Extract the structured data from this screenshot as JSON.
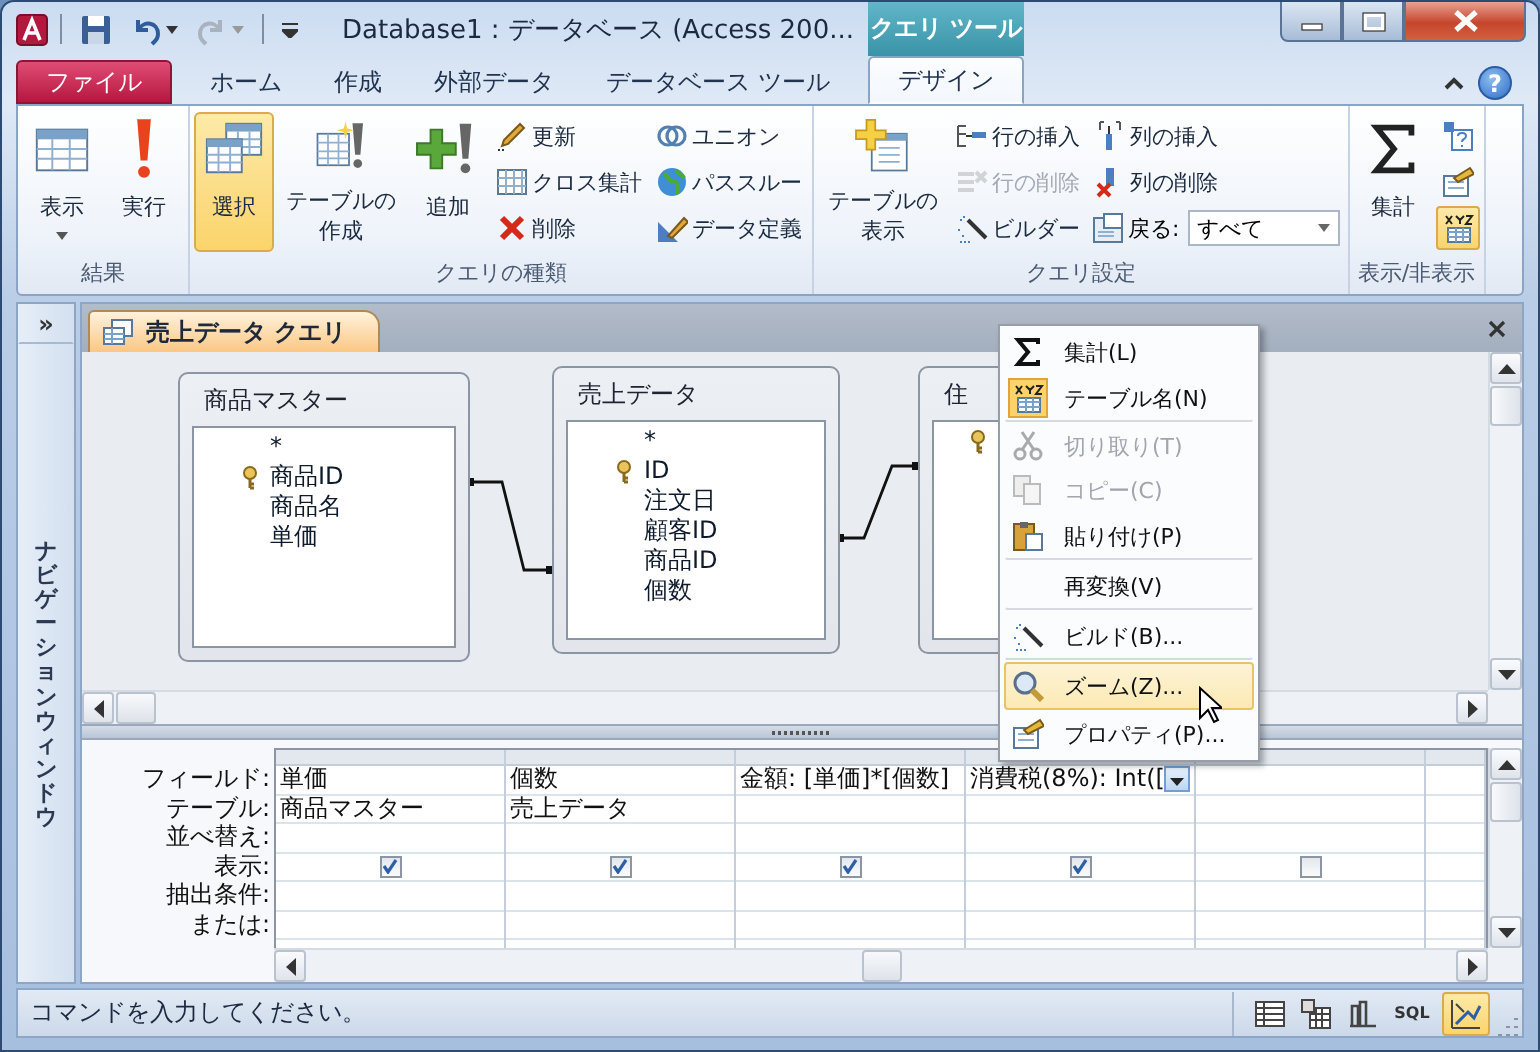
{
  "window": {
    "title": "Database1 : データベース (Access 200...",
    "context_group": "クエリ ツール",
    "help": "?"
  },
  "tabs": [
    {
      "label": "ファイル",
      "kind": "file",
      "selected": false
    },
    {
      "label": "ホーム",
      "kind": "normal",
      "selected": false
    },
    {
      "label": "作成",
      "kind": "normal",
      "selected": false
    },
    {
      "label": "外部データ",
      "kind": "normal",
      "selected": false
    },
    {
      "label": "データベース ツール",
      "kind": "normal",
      "selected": false
    },
    {
      "label": "デザイン",
      "kind": "context",
      "selected": true
    }
  ],
  "ribbon": {
    "groups": [
      {
        "label": "結果",
        "controls": [
          {
            "kind": "large",
            "label": "表示",
            "dropdown": true,
            "selected": false
          },
          {
            "kind": "large",
            "label": "実行",
            "selected": false
          }
        ]
      },
      {
        "label": "クエリの種類",
        "controls": [
          {
            "kind": "large",
            "label": "選択",
            "selected": true
          },
          {
            "kind": "large",
            "label": "テーブルの作成",
            "selected": false
          },
          {
            "kind": "large",
            "label": "追加",
            "selected": false
          },
          {
            "kind": "stack",
            "items": [
              {
                "kind": "button",
                "label": "更新",
                "disabled": false
              },
              {
                "kind": "button",
                "label": "クロス集計",
                "disabled": false
              },
              {
                "kind": "button",
                "label": "削除",
                "disabled": false
              }
            ]
          },
          {
            "kind": "stack",
            "items": [
              {
                "kind": "button",
                "label": "ユニオン",
                "disabled": false
              },
              {
                "kind": "button",
                "label": "パススルー",
                "disabled": false
              },
              {
                "kind": "button",
                "label": "データ定義",
                "disabled": false
              }
            ]
          }
        ]
      },
      {
        "label": "クエリ設定",
        "controls": [
          {
            "kind": "large",
            "label": "テーブルの表示",
            "selected": false
          },
          {
            "kind": "stack",
            "items": [
              {
                "kind": "button",
                "label": "行の挿入",
                "disabled": false
              },
              {
                "kind": "button",
                "label": "行の削除",
                "disabled": true
              },
              {
                "kind": "button",
                "label": "ビルダー",
                "disabled": false
              }
            ]
          },
          {
            "kind": "stack",
            "items": [
              {
                "kind": "button",
                "label": "列の挿入",
                "disabled": false
              },
              {
                "kind": "button",
                "label": "列の削除",
                "disabled": false
              },
              {
                "kind": "combo",
                "label": "戻る:",
                "value": "すべて"
              }
            ]
          }
        ]
      },
      {
        "label": "表示/非表示",
        "controls": [
          {
            "kind": "large",
            "label": "集計",
            "selected": false
          },
          {
            "kind": "toggles",
            "items": [
              {
                "selected": false
              },
              {
                "selected": false
              },
              {
                "selected": true
              }
            ]
          }
        ]
      }
    ]
  },
  "nav": {
    "expand": "»",
    "title": "ナビゲーションウィンドウ"
  },
  "document_tab": {
    "label": "売上データ クエリ"
  },
  "tables": [
    {
      "title": "商品マスター",
      "fields": [
        {
          "name": "*",
          "primary_key": false
        },
        {
          "name": "商品ID",
          "primary_key": true
        },
        {
          "name": "商品名",
          "primary_key": false
        },
        {
          "name": "単価",
          "primary_key": false
        }
      ]
    },
    {
      "title": "売上データ",
      "fields": [
        {
          "name": "*",
          "primary_key": false
        },
        {
          "name": "ID",
          "primary_key": true
        },
        {
          "name": "注文日",
          "primary_key": false
        },
        {
          "name": "顧客ID",
          "primary_key": false
        },
        {
          "name": "商品ID",
          "primary_key": false
        },
        {
          "name": "個数",
          "primary_key": false
        }
      ]
    },
    {
      "title": "住",
      "fields": [
        {
          "primary_key": true
        }
      ]
    }
  ],
  "grid": {
    "row_labels": [
      "フィールド:",
      "テーブル:",
      "並べ替え:",
      "表示:",
      "抽出条件:",
      "または:"
    ],
    "columns": [
      {
        "field": "単価",
        "table": "商品マスター",
        "show": true,
        "focused": false
      },
      {
        "field": "個数",
        "table": "売上データ",
        "show": true,
        "focused": false
      },
      {
        "field": "金額: [単価]*[個数]",
        "show": true,
        "focused": false
      },
      {
        "field": "消費税(8%): Int([",
        "show": true,
        "focused": true
      },
      {
        "show": false,
        "focused": false
      }
    ]
  },
  "context_menu": {
    "items": [
      {
        "label": "集計(L)",
        "checked": false,
        "disabled": false,
        "selected": false,
        "divider_after": false
      },
      {
        "label": "テーブル名(N)",
        "checked": true,
        "disabled": false,
        "selected": false,
        "divider_after": true
      },
      {
        "label": "切り取り(T)",
        "checked": false,
        "disabled": true,
        "selected": false,
        "divider_after": false
      },
      {
        "label": "コピー(C)",
        "checked": false,
        "disabled": true,
        "selected": false,
        "divider_after": false
      },
      {
        "label": "貼り付け(P)",
        "checked": false,
        "disabled": false,
        "selected": false,
        "divider_after": true
      },
      {
        "label": "再変換(V)",
        "checked": false,
        "disabled": false,
        "selected": false,
        "divider_after": true
      },
      {
        "label": "ビルド(B)...",
        "checked": false,
        "disabled": false,
        "selected": false,
        "divider_after": true
      },
      {
        "label": "ズーム(Z)...",
        "checked": false,
        "disabled": false,
        "selected": true,
        "divider_after": true
      },
      {
        "label": "プロパティ(P)...",
        "checked": false,
        "disabled": false,
        "selected": false,
        "divider_after": false
      }
    ]
  },
  "status_bar": {
    "text": "コマンドを入力してください。",
    "views": [
      {
        "selected": false
      },
      {
        "selected": false
      },
      {
        "selected": false
      },
      {
        "label": "SQL",
        "selected": false
      },
      {
        "selected": true
      }
    ]
  }
}
